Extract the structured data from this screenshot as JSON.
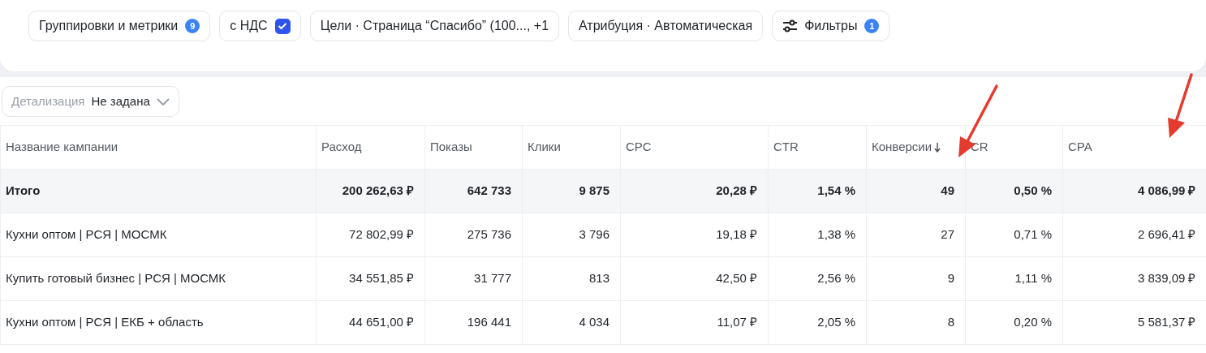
{
  "toolbar": [
    {
      "kind": "badge",
      "label": "Группировки и метрики",
      "badge": "9"
    },
    {
      "kind": "checkbox",
      "label": "с НДС",
      "checked": true
    },
    {
      "kind": "plain",
      "label": "Цели · Страница “Спасибо” (100..., +1"
    },
    {
      "kind": "plain",
      "label": "Атрибуция · Автоматическая"
    },
    {
      "kind": "filter",
      "label": "Фильтры",
      "badge": "1"
    }
  ],
  "detail": {
    "label": "Детализация",
    "value": "Не задана"
  },
  "table": {
    "columns": [
      {
        "label": "Название кампании",
        "sorted": false
      },
      {
        "label": "Расход",
        "sorted": false
      },
      {
        "label": "Показы",
        "sorted": false
      },
      {
        "label": "Клики",
        "sorted": false
      },
      {
        "label": "CPC",
        "sorted": false
      },
      {
        "label": "CTR",
        "sorted": false
      },
      {
        "label": "Конверсии",
        "sorted": true
      },
      {
        "label": "CR",
        "sorted": false
      },
      {
        "label": "CPA",
        "sorted": false
      }
    ],
    "rows": [
      {
        "total": true,
        "cells": [
          "Итого",
          "200 262,63 ₽",
          "642 733",
          "9 875",
          "20,28 ₽",
          "1,54 %",
          "49",
          "0,50 %",
          "4 086,99 ₽"
        ]
      },
      {
        "total": false,
        "cells": [
          "Кухни оптом | РСЯ | МОСМК",
          "72 802,99 ₽",
          "275 736",
          "3 796",
          "19,18 ₽",
          "1,38 %",
          "27",
          "0,71 %",
          "2 696,41 ₽"
        ]
      },
      {
        "total": false,
        "cells": [
          "Купить готовый бизнес | РСЯ | МОСМК",
          "34 551,85 ₽",
          "31 777",
          "813",
          "42,50 ₽",
          "2,56 %",
          "9",
          "1,11 %",
          "3 839,09 ₽"
        ]
      },
      {
        "total": false,
        "cells": [
          "Кухни оптом | РСЯ | ЕКБ + область",
          "44 651,00 ₽",
          "196 441",
          "4 034",
          "11,07 ₽",
          "2,05 %",
          "8",
          "0,20 %",
          "5 581,37 ₽"
        ]
      }
    ]
  }
}
